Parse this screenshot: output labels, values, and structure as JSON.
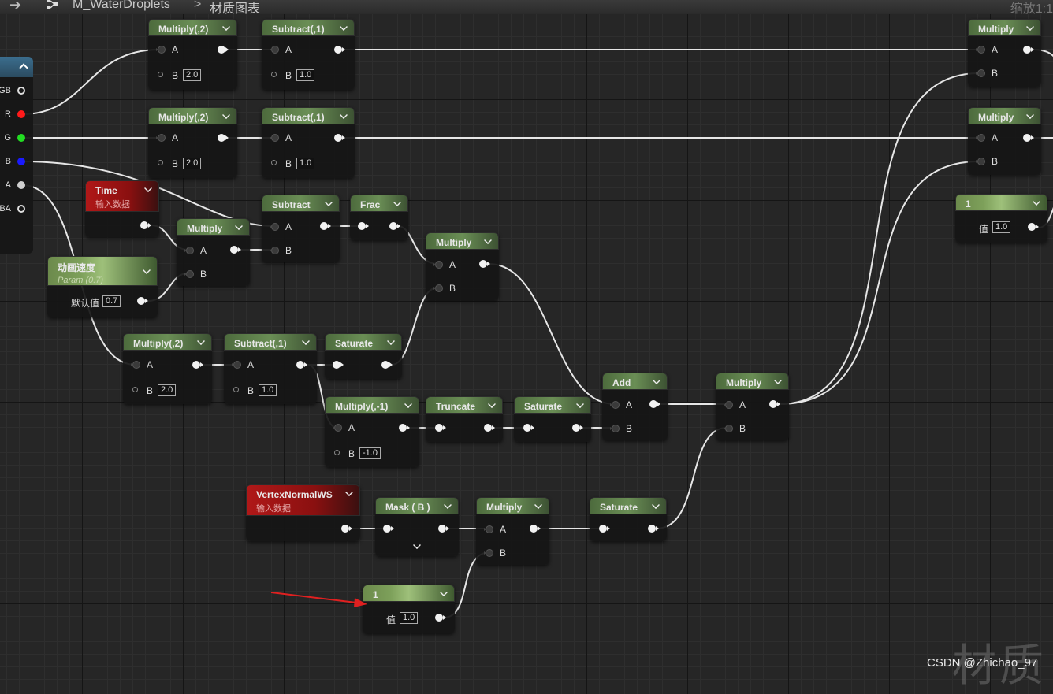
{
  "breadcrumb": {
    "asset": "M_WaterDroplets",
    "graph": "材质图表",
    "zoom": "缩放1:1"
  },
  "texture_pins": [
    "GB",
    "R",
    "G",
    "B",
    "A",
    "BA"
  ],
  "nodes": {
    "mul2_top": {
      "title": "Multiply(,2)",
      "a": "A",
      "b": "B",
      "b_val": "2.0"
    },
    "sub1_top": {
      "title": "Subtract(,1)",
      "a": "A",
      "b": "B",
      "b_val": "1.0"
    },
    "mul2_mid": {
      "title": "Multiply(,2)",
      "a": "A",
      "b": "B",
      "b_val": "2.0"
    },
    "sub1_mid": {
      "title": "Subtract(,1)",
      "a": "A",
      "b": "B",
      "b_val": "1.0"
    },
    "time": {
      "title": "Time",
      "subtitle": "输入数据"
    },
    "mul_time": {
      "title": "Multiply",
      "a": "A",
      "b": "B"
    },
    "param": {
      "title": "动画速度",
      "subtitle": "Param (0.7)",
      "label": "默认值",
      "value": "0.7"
    },
    "subtract": {
      "title": "Subtract",
      "a": "A",
      "b": "B"
    },
    "frac": {
      "title": "Frac"
    },
    "mul_frac": {
      "title": "Multiply",
      "a": "A",
      "b": "B"
    },
    "mul2_low": {
      "title": "Multiply(,2)",
      "a": "A",
      "b": "B",
      "b_val": "2.0"
    },
    "sub1_low": {
      "title": "Subtract(,1)",
      "a": "A",
      "b": "B",
      "b_val": "1.0"
    },
    "sat_low": {
      "title": "Saturate"
    },
    "mul_neg": {
      "title": "Multiply(,-1)",
      "a": "A",
      "b": "B",
      "b_val": "-1.0"
    },
    "truncate": {
      "title": "Truncate"
    },
    "sat_trunc": {
      "title": "Saturate"
    },
    "add": {
      "title": "Add",
      "a": "A",
      "b": "B"
    },
    "mul_final": {
      "title": "Multiply",
      "a": "A",
      "b": "B"
    },
    "vnws": {
      "title": "VertexNormalWS",
      "subtitle": "输入数据"
    },
    "mask": {
      "title": "Mask ( B )"
    },
    "mul_mask": {
      "title": "Multiply",
      "a": "A",
      "b": "B"
    },
    "sat_mask": {
      "title": "Saturate"
    },
    "const_bottom": {
      "title": "1",
      "label": "值",
      "value": "1.0"
    },
    "mul_r1": {
      "title": "Multiply",
      "a": "A",
      "b": "B"
    },
    "mul_r2": {
      "title": "Multiply",
      "a": "A",
      "b": "B"
    },
    "const_right": {
      "title": "1",
      "label": "值",
      "value": "1.0"
    }
  },
  "watermark": "材质",
  "credit": "CSDN @Zhichao_97",
  "colors": {
    "wire": "#e6e6e6",
    "pin_r": "#ff1a1a",
    "pin_g": "#22dd22",
    "pin_b": "#1a1aff",
    "arrow": "#e02020"
  }
}
